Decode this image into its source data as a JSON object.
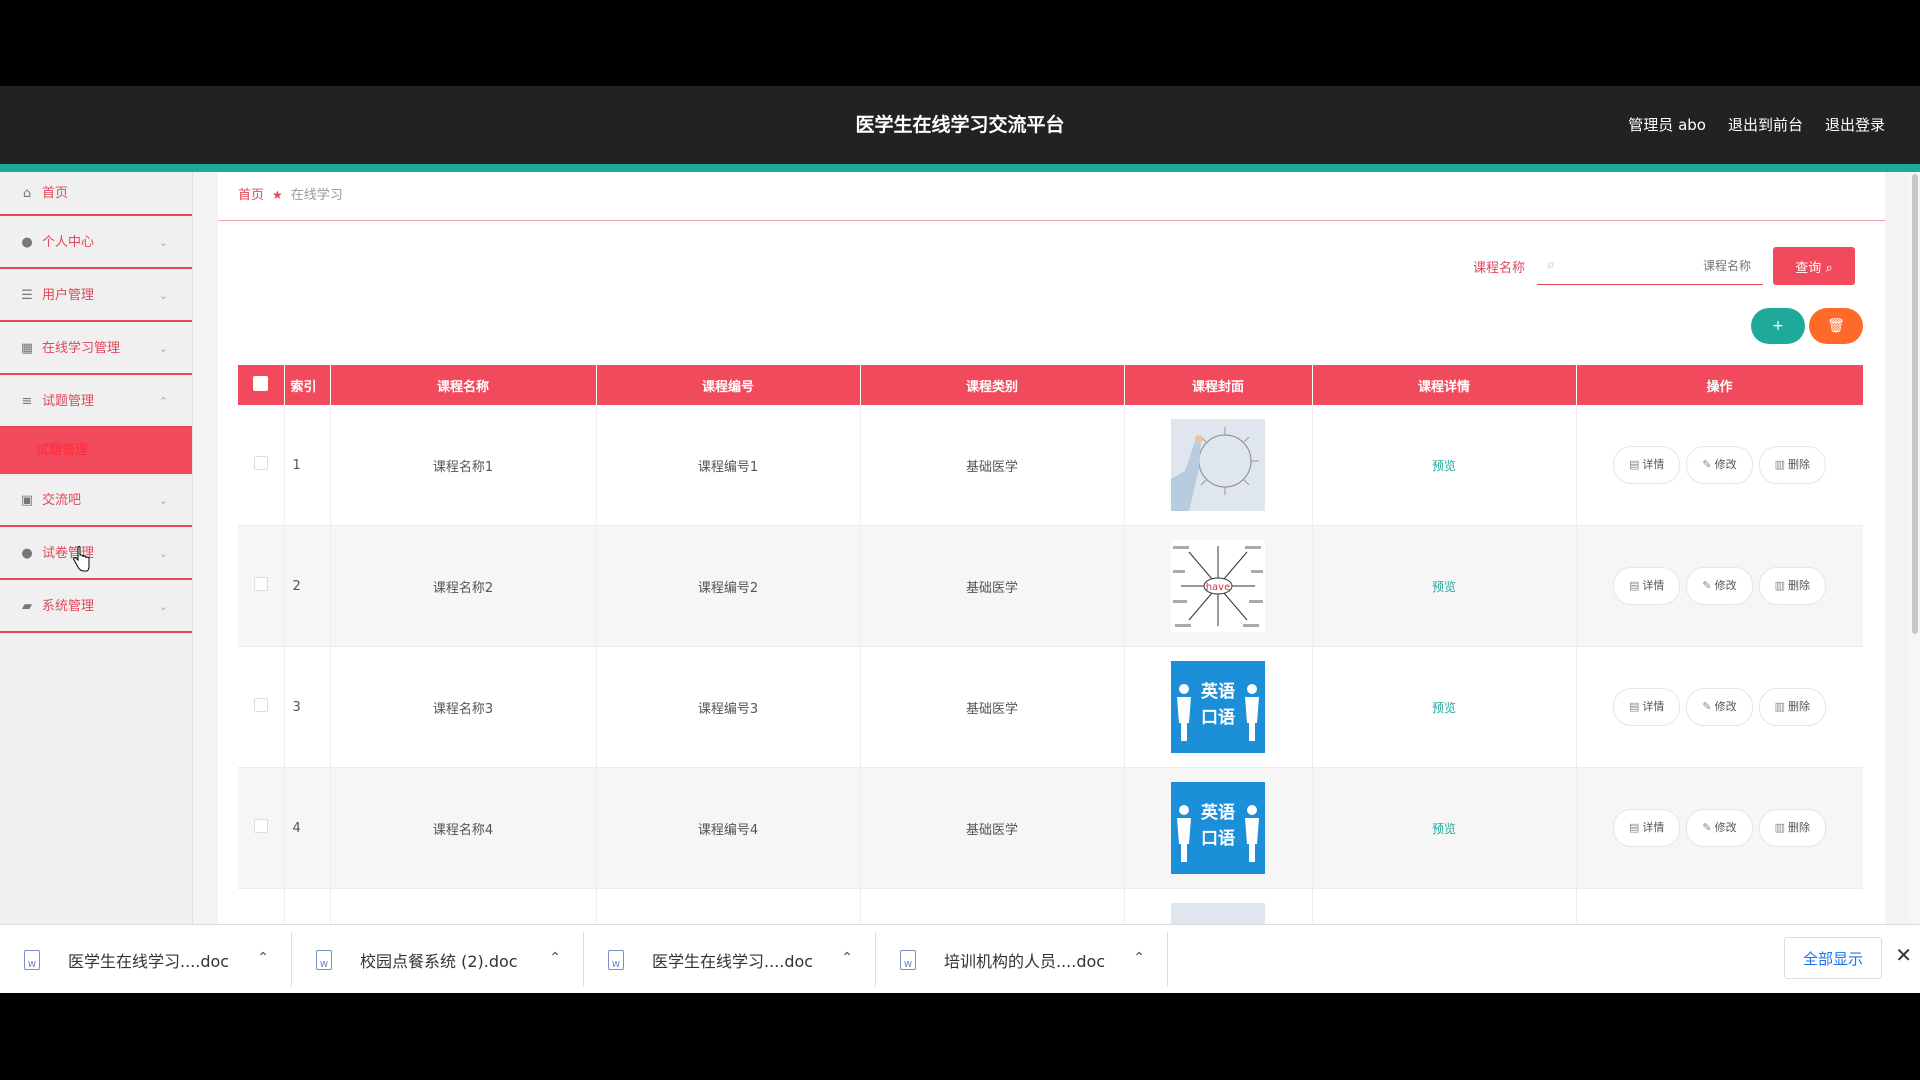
{
  "app": {
    "title": "医学生在线学习交流平台",
    "user": "管理员 abo",
    "to_front": "退出到前台",
    "logout": "退出登录"
  },
  "sidebar": {
    "items": [
      {
        "label": "首页",
        "icon": "home-icon"
      },
      {
        "label": "个人中心",
        "icon": "person-icon"
      },
      {
        "label": "用户管理",
        "icon": "list-icon"
      },
      {
        "label": "在线学习管理",
        "icon": "grid-icon"
      },
      {
        "label": "试题管理",
        "icon": "sliders-icon"
      },
      {
        "label": "交流吧",
        "icon": "clipboard-icon"
      },
      {
        "label": "试卷管理",
        "icon": "person-icon"
      },
      {
        "label": "系统管理",
        "icon": "briefcase-icon"
      }
    ],
    "sub_item": "试题管理"
  },
  "breadcrumb": {
    "home": "首页",
    "current": "在线学习"
  },
  "search": {
    "label": "课程名称",
    "placeholder": "课程名称",
    "button": "查询"
  },
  "table": {
    "headers": [
      "索引",
      "课程名称",
      "课程编号",
      "课程类别",
      "课程封面",
      "课程详情",
      "操作"
    ],
    "rows": [
      {
        "idx": "1",
        "name": "课程名称1",
        "code": "课程编号1",
        "category": "基础医学",
        "detail": "预览",
        "cover": "business-training"
      },
      {
        "idx": "2",
        "name": "课程名称2",
        "code": "课程编号2",
        "category": "基础医学",
        "detail": "预览",
        "cover": "have-mindmap"
      },
      {
        "idx": "3",
        "name": "课程名称3",
        "code": "课程编号3",
        "category": "基础医学",
        "detail": "预览",
        "cover": "english-speaking"
      },
      {
        "idx": "4",
        "name": "课程名称4",
        "code": "课程编号4",
        "category": "基础医学",
        "detail": "预览",
        "cover": "english-speaking"
      }
    ],
    "ops": {
      "detail": "详情",
      "edit": "修改",
      "delete": "删除"
    }
  },
  "cover_text": {
    "en1": "英语",
    "en2": "口语",
    "have": "have"
  },
  "downloads": {
    "items": [
      "医学生在线学习....doc",
      "校园点餐系统 (2).doc",
      "医学生在线学习....doc",
      "培训机构的人员....doc"
    ],
    "show_all": "全部显示"
  },
  "colors": {
    "accent": "#f04a5c",
    "teal": "#1fa99a",
    "orange": "#ff6a2a"
  }
}
